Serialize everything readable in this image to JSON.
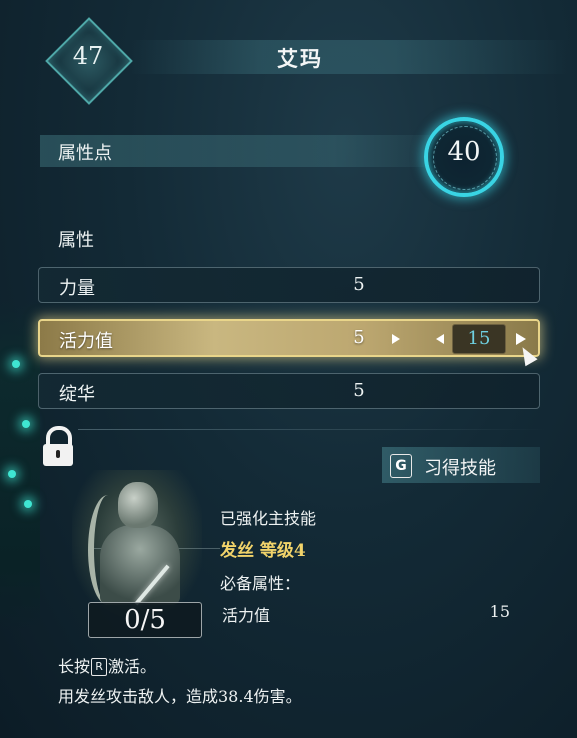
{
  "character": {
    "level": "47",
    "name": "艾玛"
  },
  "attribute_points": {
    "label": "属性点",
    "value": "40"
  },
  "attributes": {
    "title": "属性",
    "rows": [
      {
        "label": "力量",
        "value": "5"
      },
      {
        "label": "活力值",
        "value": "5",
        "new_value": "15",
        "selected": true
      },
      {
        "label": "绽华",
        "value": "5"
      }
    ]
  },
  "learn_skill": {
    "key": "G",
    "label": "习得技能"
  },
  "skill": {
    "counter": "0/5",
    "type": "已强化主技能",
    "name": "发丝 等级4",
    "requirement_title": "必备属性：",
    "requirement_attr": "活力值",
    "requirement_value": "15",
    "hint_prefix": "长按",
    "hint_key": "R",
    "hint_suffix": "激活。",
    "description": "用发丝攻击敌人，造成38.4伤害。"
  },
  "colors": {
    "accent_cyan": "#39d4e4",
    "highlight_gold": "#e9d58a",
    "skill_name": "#f1d36a"
  },
  "icons": [
    "lock-icon",
    "arrow-right-icon",
    "arrow-left-icon",
    "cursor-icon"
  ]
}
